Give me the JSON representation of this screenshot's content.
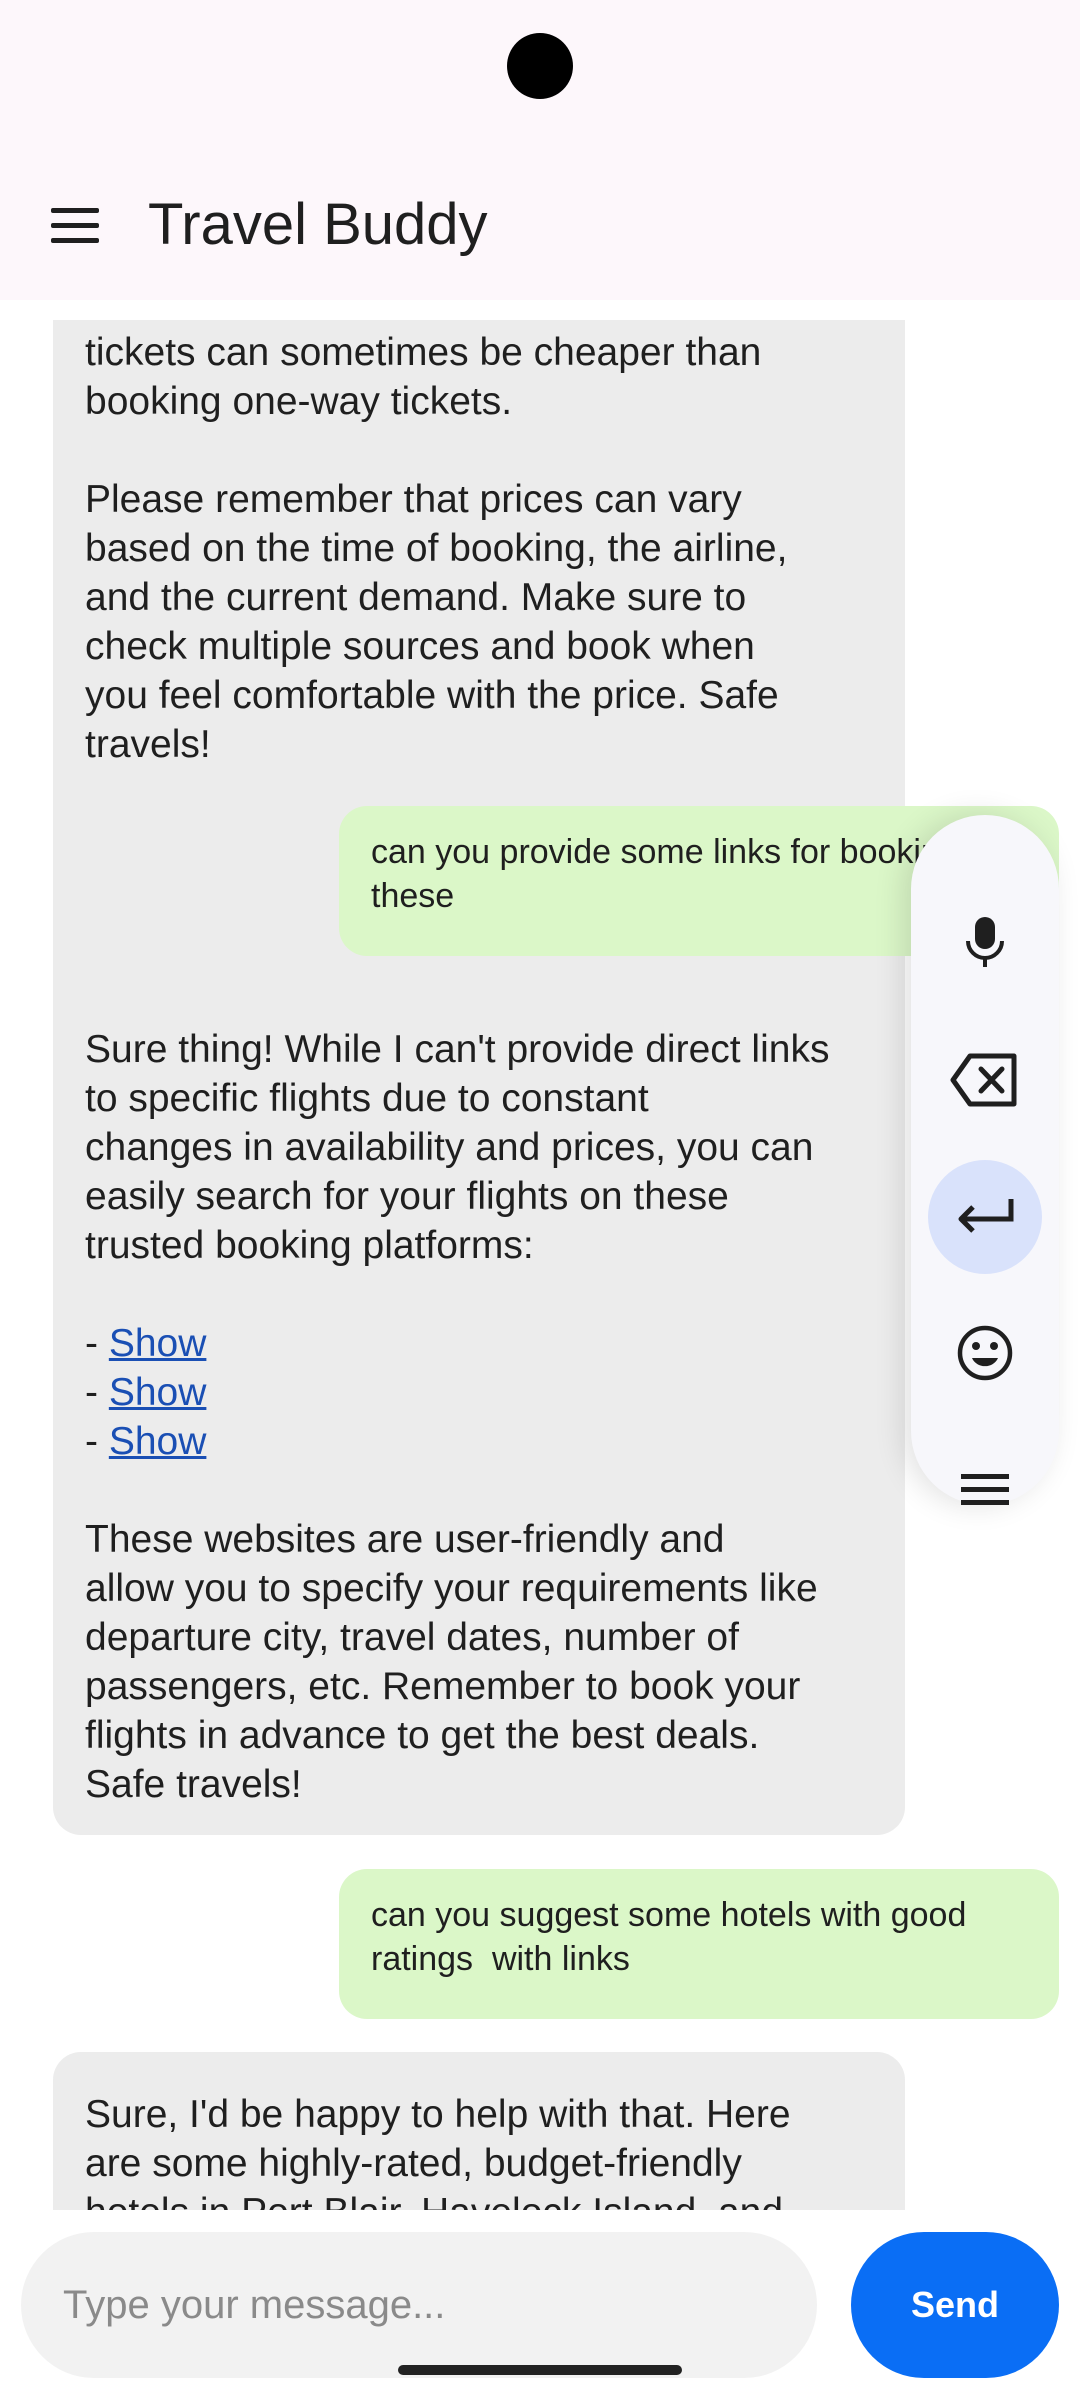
{
  "app": {
    "title": "Travel Buddy"
  },
  "messages": {
    "bot1": {
      "text": "tickets can sometimes be cheaper than\nbooking one-way tickets.\n\nPlease remember that prices can vary\nbased on the time of booking, the airline,\nand the current demand. Make sure to\ncheck multiple sources and book when\nyou feel comfortable with the price. Safe\ntravels!"
    },
    "user1": {
      "text": "can you provide some links for booking\nthese"
    },
    "bot2": {
      "intro": "Sure thing! While I can't provide direct links\nto specific flights due to constant\nchanges in availability and prices, you can\neasily search for your flights on these\ntrusted booking platforms:",
      "link_prefix": "- ",
      "links": [
        "Show",
        "Show",
        "Show"
      ],
      "outro": "These websites are user-friendly and\nallow you to specify your requirements like\ndeparture city, travel dates, number of\npassengers, etc. Remember to book your\nflights in advance to get the best deals.\nSafe travels!"
    },
    "user2": {
      "text": "can you suggest some hotels with good\nratings  with links"
    },
    "bot3": {
      "text": "Sure, I'd be happy to help with that. Here\nare some highly-rated, budget-friendly\nhotels in Port Blair, Havelock Island, and"
    }
  },
  "toolbar": {
    "icons": [
      "mic-icon",
      "backspace-icon",
      "enter-icon",
      "emoji-icon",
      "menu-icon"
    ]
  },
  "input": {
    "placeholder": "Type your message...",
    "value": ""
  },
  "send": {
    "label": "Send"
  },
  "colors": {
    "accent": "#0a6ef5",
    "user_bubble": "#dbf7c8",
    "bot_bubble": "#ececec",
    "link": "#1a4fb4"
  }
}
